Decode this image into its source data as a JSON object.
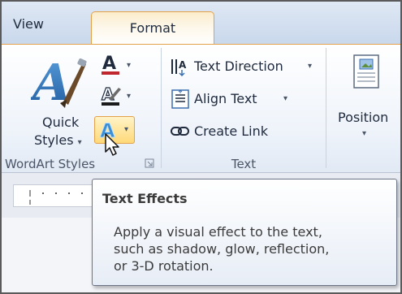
{
  "tabs": {
    "view": "View",
    "format": "Format"
  },
  "wordart_group": {
    "quick_styles_line1": "Quick",
    "quick_styles_line2": "Styles",
    "label": "WordArt Styles",
    "dropdown_glyph": "▾",
    "launcher_icon": "dialog-launcher-icon"
  },
  "text_group": {
    "text_direction": "Text Direction",
    "align_text": "Align Text",
    "create_link": "Create Link",
    "label": "Text",
    "dropdown_glyph": "▾"
  },
  "arrange_group": {
    "position": "Position",
    "dropdown_glyph": "▾"
  },
  "tooltip": {
    "title": "Text Effects",
    "line1": "Apply a visual effect to the text,",
    "line2": "such as shadow, glow, reflection,",
    "line3": "or 3-D rotation."
  },
  "colors": {
    "accent_orange": "#e3a24a",
    "text_fill_red": "#c0262d",
    "text_effects_blue": "#3b8fd6"
  }
}
